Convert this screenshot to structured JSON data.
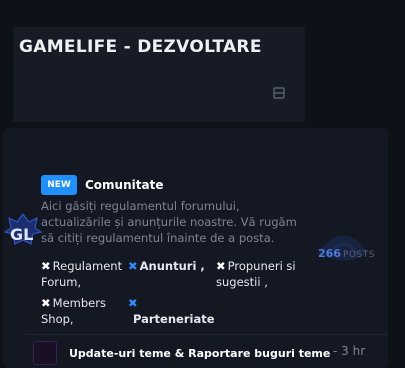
{
  "header": {
    "title": "GAMELIFE - DEZVOLTARE",
    "collapse_icon": "collapse-icon"
  },
  "forum": {
    "badge": "NEW",
    "title": "Comunitate",
    "description": "Aici găsiți regulamentul forumului, actualizările și anunțurile noastre. Vă rugăm să citiți regulamentul înainte de a posta.",
    "posts_count": "266",
    "posts_label": "POSTS",
    "logo_icon": "gamelife-logo-icon",
    "subforums": [
      {
        "line1": "Regulament",
        "line2": "Forum,"
      },
      {
        "label": "Anunturi ,"
      },
      {
        "line1": "Propuneri si",
        "line2": "sugestii ,"
      },
      {
        "line1": "Members",
        "line2": "Shop,"
      },
      {
        "label": "Parteneriate"
      }
    ]
  },
  "latest": {
    "title": "Update-uri teme & Raportare buguri teme",
    "time": "- 3 hr"
  },
  "colors": {
    "accent": "#1e90ff",
    "background": "#0e1118",
    "card": "#141823"
  }
}
